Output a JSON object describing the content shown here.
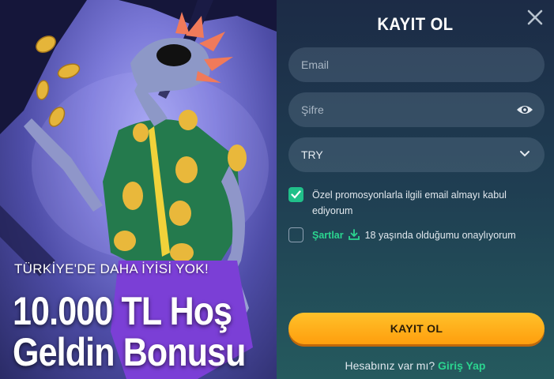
{
  "promo": {
    "tagline": "TÜRKİYE'DE DAHA İYİSİ YOK!",
    "headline_line1": "10.000 TL Hoş",
    "headline_line2": "Geldin Bonusu"
  },
  "form": {
    "title": "KAYIT OL",
    "close_icon": "close-icon",
    "email": {
      "placeholder": "Email",
      "value": ""
    },
    "password": {
      "placeholder": "Şifre",
      "value": "",
      "icon": "eye-icon"
    },
    "currency": {
      "selected": "TRY",
      "icon": "chevron-down-icon"
    },
    "promo_consent": {
      "checked": true,
      "label": "Özel promosyonlarla ilgili email almayı kabul ediyorum"
    },
    "age_consent": {
      "checked": false,
      "terms_link": "Şartlar",
      "label": "18 yaşında olduğumu onaylıyorum"
    },
    "submit_label": "KAYIT OL",
    "login_prompt": "Hesabınız var mı?",
    "login_link": "Giriş Yap"
  },
  "colors": {
    "accent_green": "#2bd48f",
    "button_orange": "#ffb21c",
    "panel_bg": "#1f3e52"
  }
}
